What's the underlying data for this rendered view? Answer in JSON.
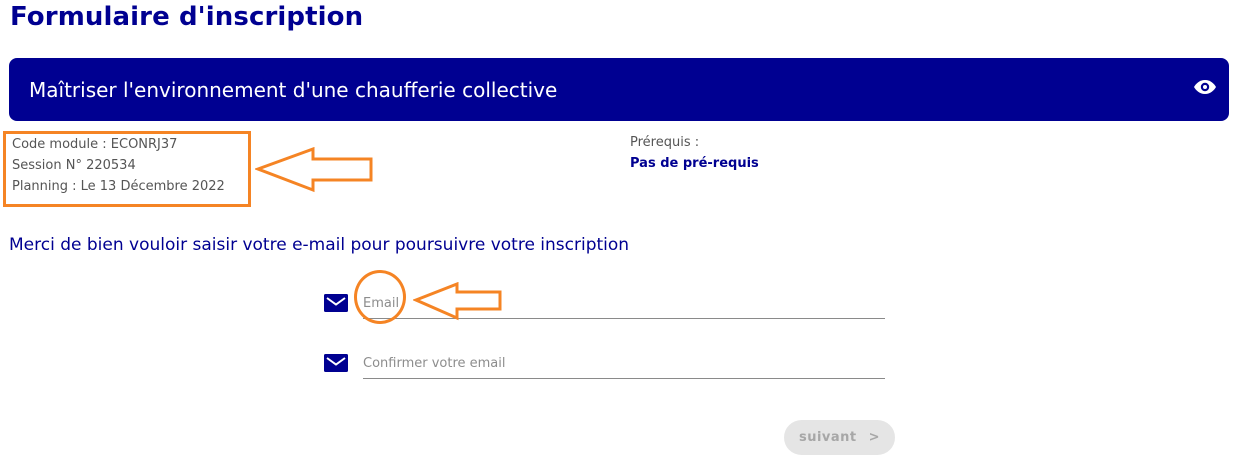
{
  "page": {
    "title": "Formulaire d'inscription"
  },
  "module": {
    "title": "Maîtriser l'environnement d'une chaufferie collective",
    "eye_icon": "eye-icon"
  },
  "info": {
    "code_module": "Code module : ECONRJ37",
    "session": "Session N° 220534",
    "planning": "Planning : Le 13 Décembre 2022"
  },
  "prerequisites": {
    "label": "Prérequis :",
    "value": "Pas de pré-requis"
  },
  "instruction": "Merci de bien vouloir saisir votre e-mail pour poursuivre votre inscription",
  "form": {
    "email_placeholder": "Email",
    "email_value": "",
    "confirm_placeholder": "Confirmer votre email",
    "confirm_value": "",
    "icon": "envelope-icon",
    "next_label": "suivant",
    "next_chevron": ">"
  },
  "colors": {
    "primary": "#000091",
    "annotation": "#f58424",
    "button_disabled_bg": "#e5e5e5",
    "button_disabled_text": "#a7a7a7"
  }
}
